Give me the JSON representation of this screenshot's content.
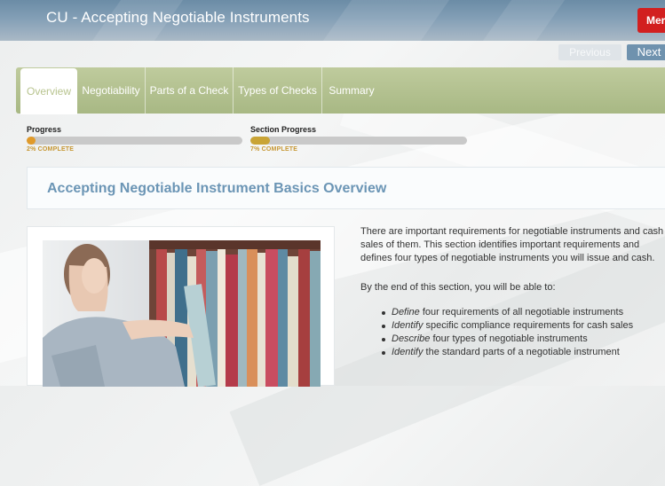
{
  "header": {
    "title": "CU - Accepting Negotiable Instruments",
    "menu_label": "Mer"
  },
  "nav": {
    "previous_label": "Previous",
    "next_label": "Next"
  },
  "tabs": [
    {
      "label": "Overview",
      "active": true
    },
    {
      "label": "Negotiability",
      "active": false
    },
    {
      "label": "Parts of a Check",
      "active": false
    },
    {
      "label": "Types of Checks",
      "active": false
    },
    {
      "label": "Summary",
      "active": false
    }
  ],
  "progress": {
    "overall": {
      "label": "Progress",
      "percent_text": "2% COMPLETE",
      "value": 0.02
    },
    "section": {
      "label": "Section Progress",
      "percent_text": "7% COMPLETE",
      "value": 0.07
    }
  },
  "content": {
    "heading": "Accepting Negotiable Instrument Basics Overview",
    "paragraph1": "There are important requirements for negotiable instruments and cash sales of them. This section identifies important requirements and defines four types of negotiable instruments you will issue and cash.",
    "paragraph2": "By the end of this section, you will be able to:",
    "objectives": [
      {
        "verb": "Define",
        "rest": " four requirements of all negotiable instruments"
      },
      {
        "verb": "Identify",
        "rest": " specific compliance requirements for cash sales"
      },
      {
        "verb": "Describe",
        "rest": " four types of negotiable instruments"
      },
      {
        "verb": "Identify",
        "rest": " the standard parts of a negotiable instrument"
      }
    ]
  },
  "colors": {
    "header_blue": "#7f9cb3",
    "tab_green": "#b3c190",
    "menu_red": "#d21f1f",
    "heading_blue": "#6b95b5",
    "progress_orange": "#e09a2a"
  }
}
